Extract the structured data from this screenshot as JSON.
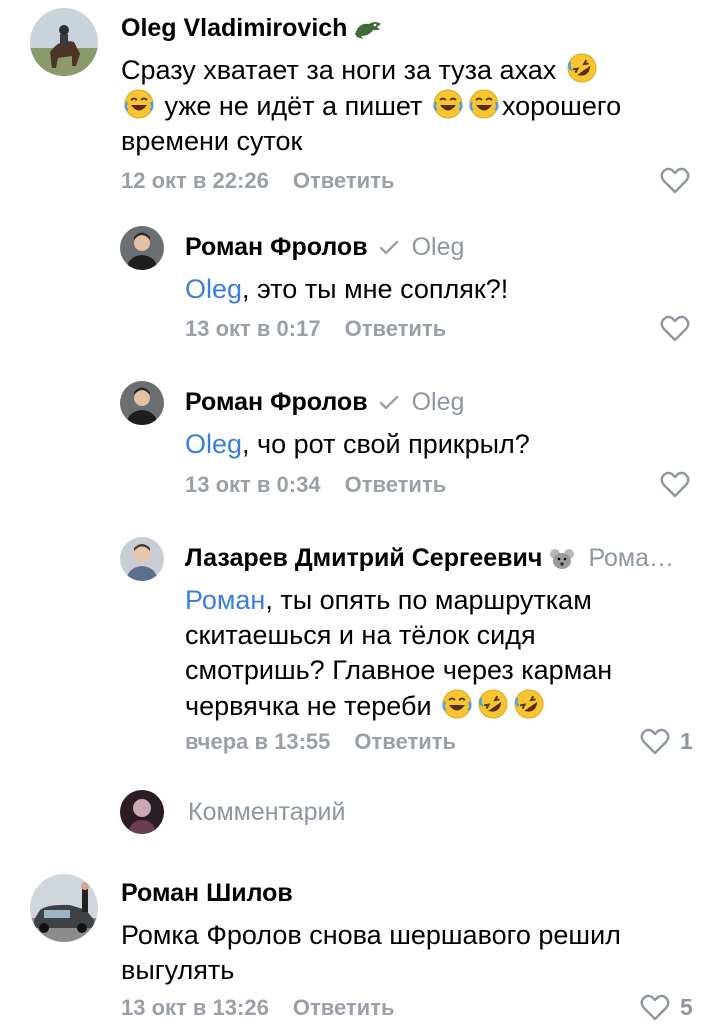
{
  "comments": [
    {
      "author": "Oleg Vladimirovich",
      "text_line1": "Сразу хватает за ноги за  туза ахах",
      "text_line2_b": "уже не идёт а пишет",
      "text_line2_d": "хорошего",
      "text_line3": "времени суток",
      "date": "12 окт в 22:26",
      "reply_label": "Ответить"
    },
    {
      "author": "Роман Фролов",
      "reply_to": "Oleg",
      "mention": "Oleg",
      "text": ", это ты мне сопляк?!",
      "date": "13 окт в 0:17",
      "reply_label": "Ответить"
    },
    {
      "author": "Роман Фролов",
      "reply_to": "Oleg",
      "mention": "Oleg",
      "text": ", чо рот свой прикрыл?",
      "date": "13 окт в 0:34",
      "reply_label": "Ответить"
    },
    {
      "author": "Лазарев Дмитрий Сергеевич",
      "reply_to": "Рома…",
      "mention": "Роман",
      "text_line1": ", ты опять по маршруткам",
      "text_line2": "скитаешься и на тёлок сидя",
      "text_line3": "смотришь? Главное через карман",
      "text_line4": "червячка не тереби",
      "date": "вчера в 13:55",
      "reply_label": "Ответить",
      "likes": "1"
    },
    {
      "author": "Роман Шилов",
      "text_line1": "Ромка Фролов снова шершавого решил",
      "text_line2": "выгулять",
      "date": "13 окт в 13:26",
      "reply_label": "Ответить",
      "likes": "5"
    }
  ],
  "comment_input": {
    "placeholder": "Комментарий"
  },
  "icons": {
    "like": "heart-outline-icon",
    "verified": "checkmark-icon",
    "laugh": "face-with-tears-of-joy",
    "rofl": "rolling-on-floor-laughing"
  },
  "colors": {
    "mention": "#3a7fe0",
    "meta": "#9aa0a8",
    "emoji": "#f7c531"
  }
}
